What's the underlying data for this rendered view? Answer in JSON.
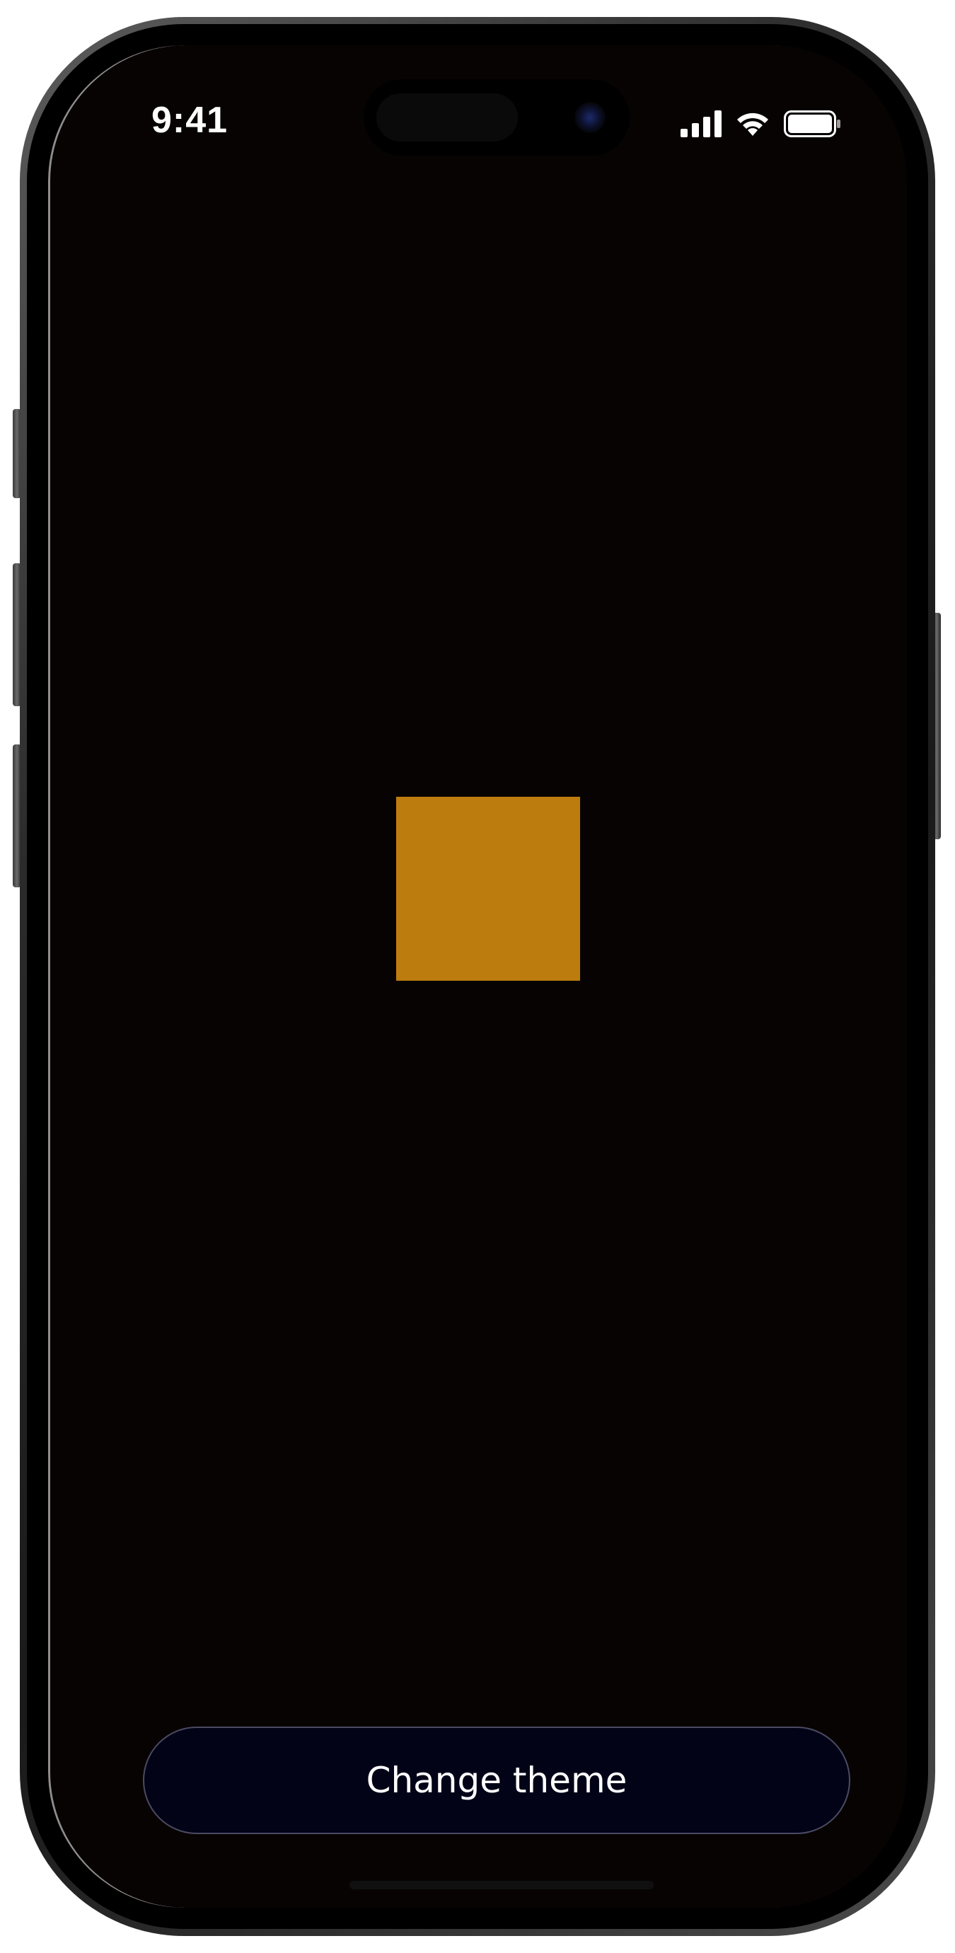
{
  "status_bar": {
    "time": "9:41",
    "icons": [
      "cellular-signal-icon",
      "wifi-icon",
      "battery-icon"
    ]
  },
  "content": {
    "square_color": "#bd7c0e",
    "background_color": "#080303"
  },
  "theme_button": {
    "label": "Change theme",
    "background": "#030317"
  }
}
